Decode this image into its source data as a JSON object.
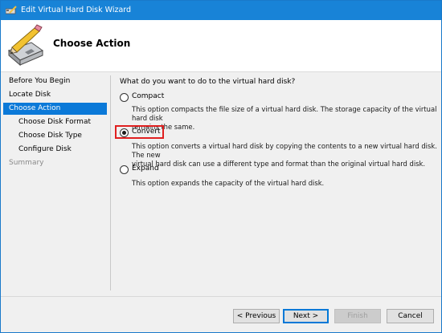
{
  "window": {
    "title": "Edit Virtual Hard Disk Wizard"
  },
  "header": {
    "page_title": "Choose Action"
  },
  "sidebar": {
    "steps": [
      {
        "label": "Before You Begin"
      },
      {
        "label": "Locate Disk"
      },
      {
        "label": "Choose Action",
        "state": "active"
      },
      {
        "label": "Choose Disk Format"
      },
      {
        "label": "Choose Disk Type"
      },
      {
        "label": "Configure Disk"
      },
      {
        "label": "Summary",
        "state": "disabled"
      }
    ]
  },
  "main": {
    "question": "What do you want to do to the virtual hard disk?",
    "options": [
      {
        "label": "Compact",
        "checked": false,
        "desc_1": "This option compacts the file size of a virtual hard disk. The storage capacity of the virtual hard disk",
        "desc_2": "remains the same."
      },
      {
        "label": "Convert",
        "checked": true,
        "desc_1": "This option converts a virtual hard disk by copying the contents to a new virtual hard disk. The new",
        "desc_2": "virtual hard disk can use a different type and format than the original virtual hard disk."
      },
      {
        "label": "Expand",
        "checked": false,
        "desc_1": "This option expands the capacity of the virtual hard disk."
      }
    ]
  },
  "footer": {
    "previous": "< Previous",
    "next": "Next >",
    "finish": "Finish",
    "cancel": "Cancel"
  },
  "colors": {
    "titlebar": "#1883d7",
    "active_step": "#0b79d8",
    "highlight": "#e02020"
  }
}
